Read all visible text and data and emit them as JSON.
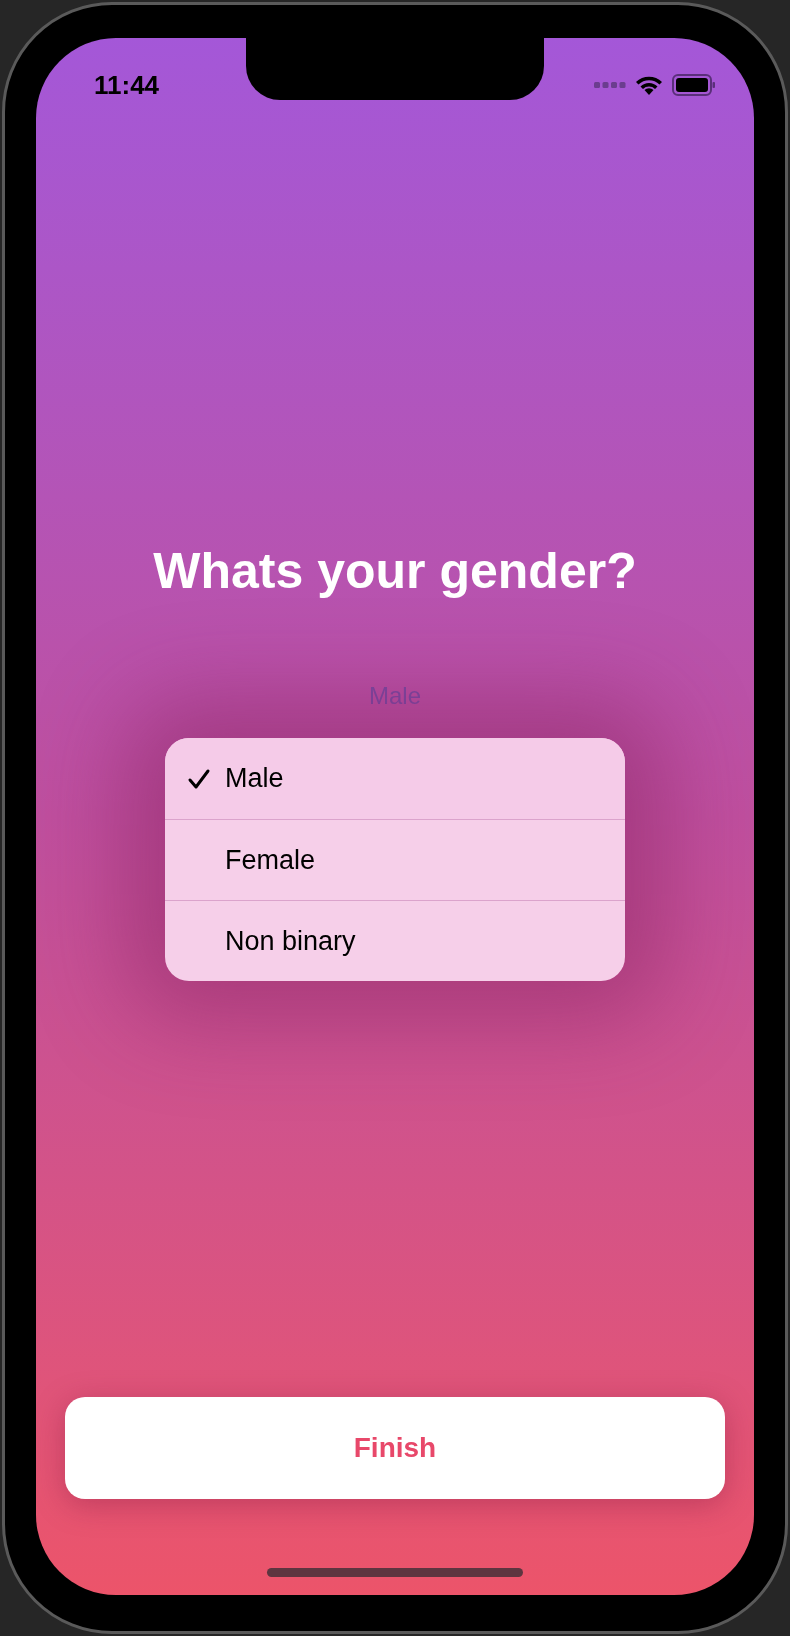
{
  "status_bar": {
    "time": "11:44"
  },
  "title": "Whats your gender?",
  "picker": {
    "value": "Male"
  },
  "menu": [
    {
      "label": "Male",
      "selected": true
    },
    {
      "label": "Female",
      "selected": false
    },
    {
      "label": "Non binary",
      "selected": false
    }
  ],
  "finish_button": {
    "label": "Finish"
  }
}
